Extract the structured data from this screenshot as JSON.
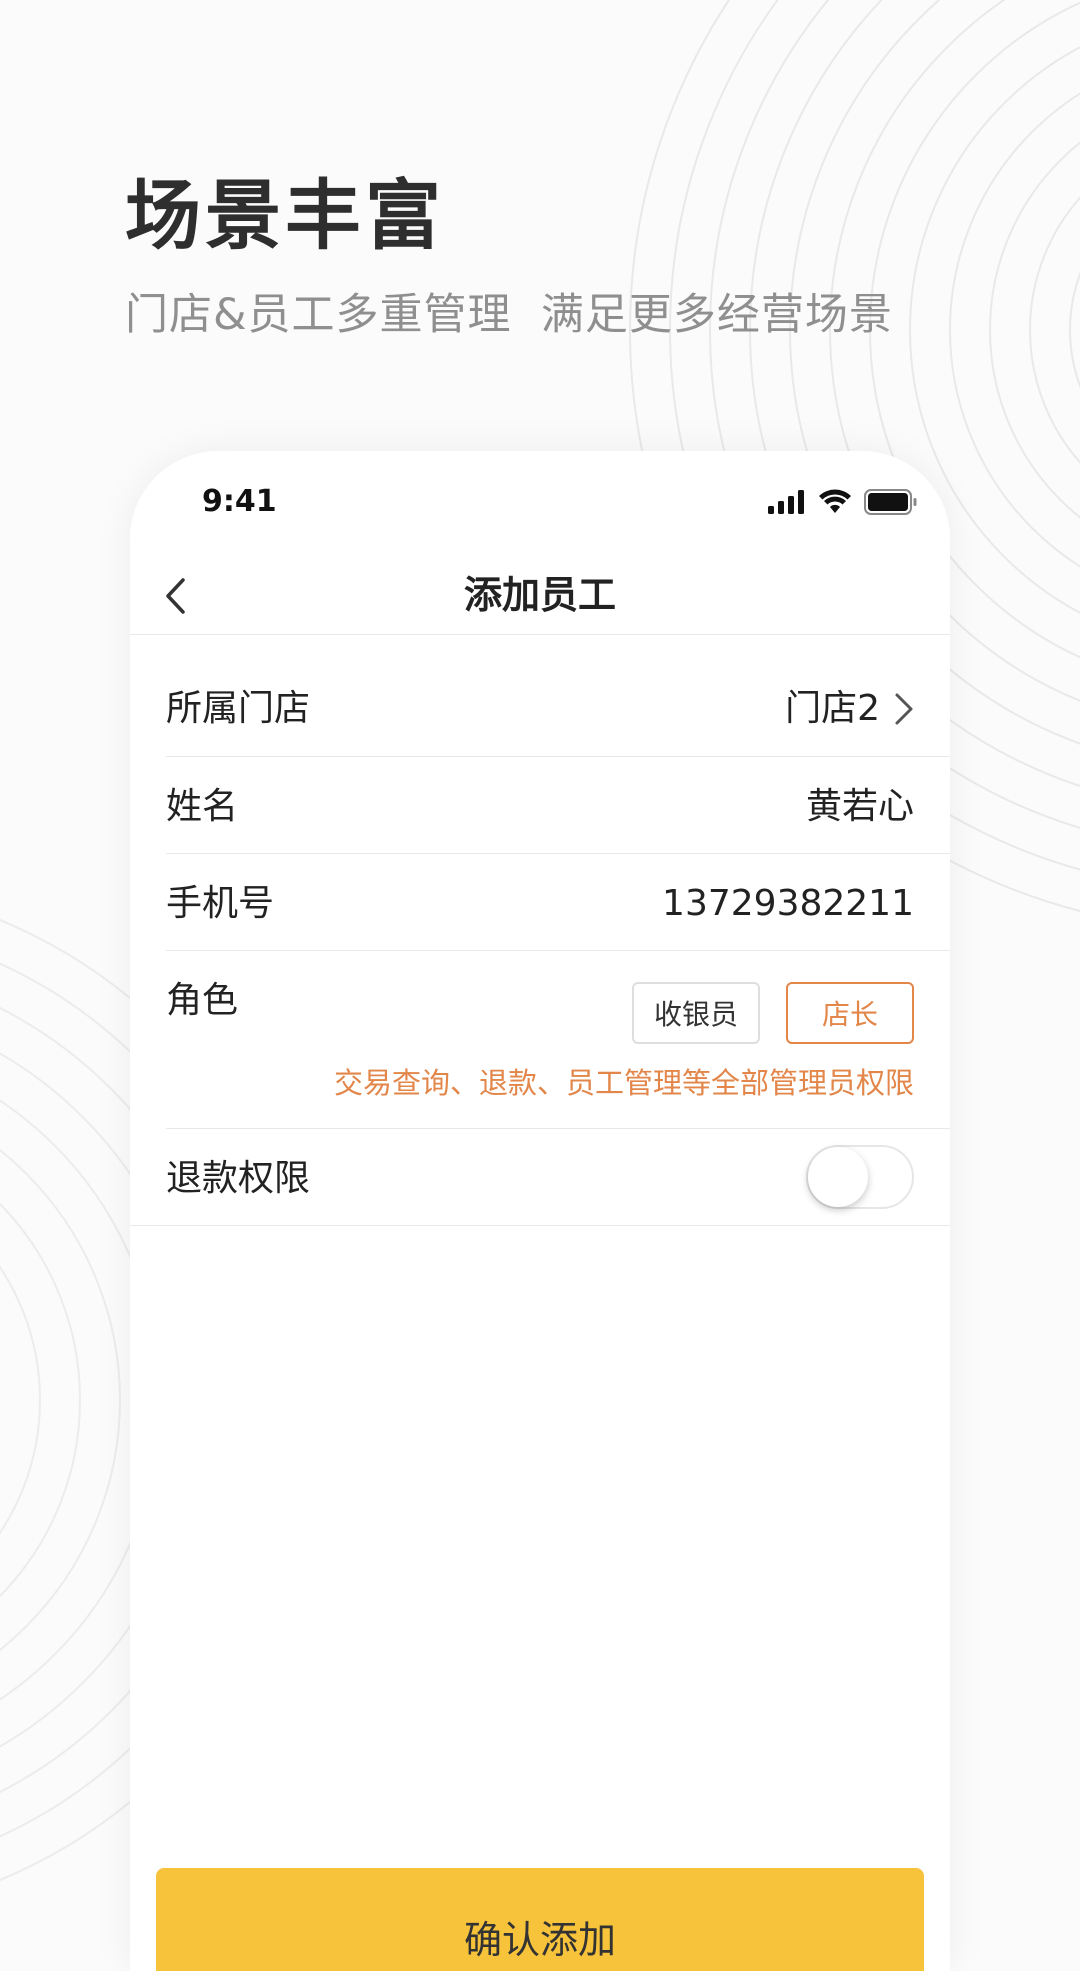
{
  "promo": {
    "headline": "场景丰富",
    "subline": "门店&员工多重管理  满足更多经营场景"
  },
  "status_bar": {
    "time": "9:41",
    "icons": [
      "signal-icon",
      "wifi-icon",
      "battery-icon"
    ]
  },
  "nav": {
    "back_icon": "chevron-left-icon",
    "title": "添加员工"
  },
  "form": {
    "store": {
      "label": "所属门店",
      "value": "门店2",
      "icon": "chevron-right-icon"
    },
    "name": {
      "label": "姓名",
      "value": "黄若心"
    },
    "phone": {
      "label": "手机号",
      "value": "13729382211"
    },
    "role": {
      "label": "角色",
      "options": [
        "收银员",
        "店长"
      ],
      "selected": "店长",
      "hint": "交易查询、退款、员工管理等全部管理员权限"
    },
    "refund": {
      "label": "退款权限",
      "enabled": false
    }
  },
  "confirm_button": {
    "label": "确认添加"
  },
  "colors": {
    "accent": "#e2864a",
    "primary_button": "#f6c33a",
    "text": "#222222",
    "subtext": "#8f8f8f"
  }
}
